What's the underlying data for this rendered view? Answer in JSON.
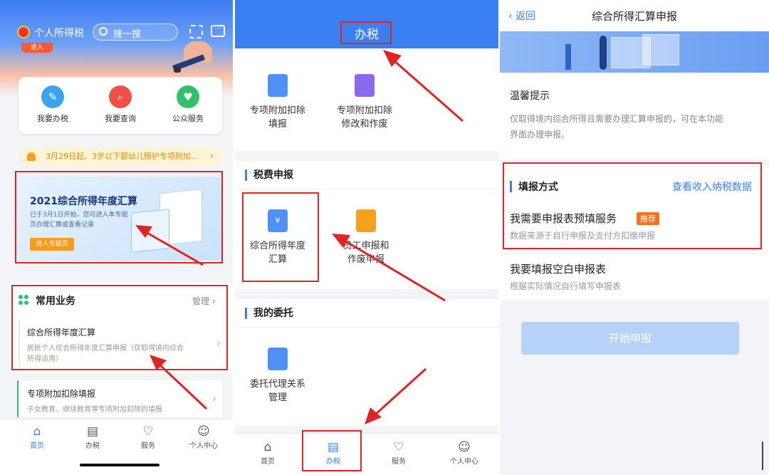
{
  "panel1": {
    "app_title": "个人所得税",
    "search_placeholder": "搜一搜",
    "hero_button": "进入",
    "quick": [
      {
        "label": "我要办税",
        "color": "#3aa4ef",
        "icon": "pen-icon"
      },
      {
        "label": "我要查询",
        "color": "#ef4f44",
        "icon": "search-icon"
      },
      {
        "label": "公众服务",
        "color": "#32c06c",
        "icon": "heart-icon"
      }
    ],
    "notice": "3月29日起，3岁以下婴幼儿照护专项附加...",
    "banner": {
      "title": "2021综合所得年度汇算",
      "desc_line1": "已于3月1日开始，您可进入本专题",
      "desc_line2": "页办理汇算或查看记录",
      "button": "进入专题页"
    },
    "common": {
      "title": "常用业务",
      "manage": "管理",
      "items": [
        {
          "title": "综合所得年度汇算",
          "desc_line1": "居民个人综合所得年度汇算申报（仅取得境内综合",
          "desc_line2": "所得适用）"
        },
        {
          "title": "专项附加扣除填报",
          "desc_line1": "子女教育、继续教育等专项附加扣除的填报",
          "desc_line2": ""
        }
      ]
    },
    "tabs": [
      "首页",
      "办税",
      "服务",
      "个人中心"
    ]
  },
  "panel2": {
    "title": "办税",
    "top_items": [
      {
        "line1": "专项附加扣除",
        "line2": "填报"
      },
      {
        "line1": "专项附加扣除",
        "line2": "修改和作废"
      }
    ],
    "section_tax": "税费申报",
    "tax_items": [
      {
        "line1": "综合所得年度",
        "line2": "汇算"
      },
      {
        "line1": "员工申报和",
        "line2": "作废申报"
      }
    ],
    "section_entrust": "我的委托",
    "entrust_items": [
      {
        "line1": "委托代理关系",
        "line2": "管理"
      }
    ],
    "tabs": [
      "首页",
      "办税",
      "服务",
      "个人中心"
    ]
  },
  "panel3": {
    "back": "返回",
    "title": "综合所得汇算申报",
    "tip_title": "温馨提示",
    "tip_line1": "仅取得境内综合所得且需要办理汇算申报的，可在本功能",
    "tip_line2": "界面办理申报。",
    "method_title": "填报方式",
    "method_link": "查看收入纳税数据",
    "option1": {
      "title": "我需要申报表预填服务",
      "badge": "推荐",
      "desc": "数据来源于自行申报及支付方扣缴申报"
    },
    "option2": {
      "title": "我要填报空白申报表",
      "desc": "根据实际情况自行填写申报表"
    },
    "start_button": "开始申报"
  }
}
